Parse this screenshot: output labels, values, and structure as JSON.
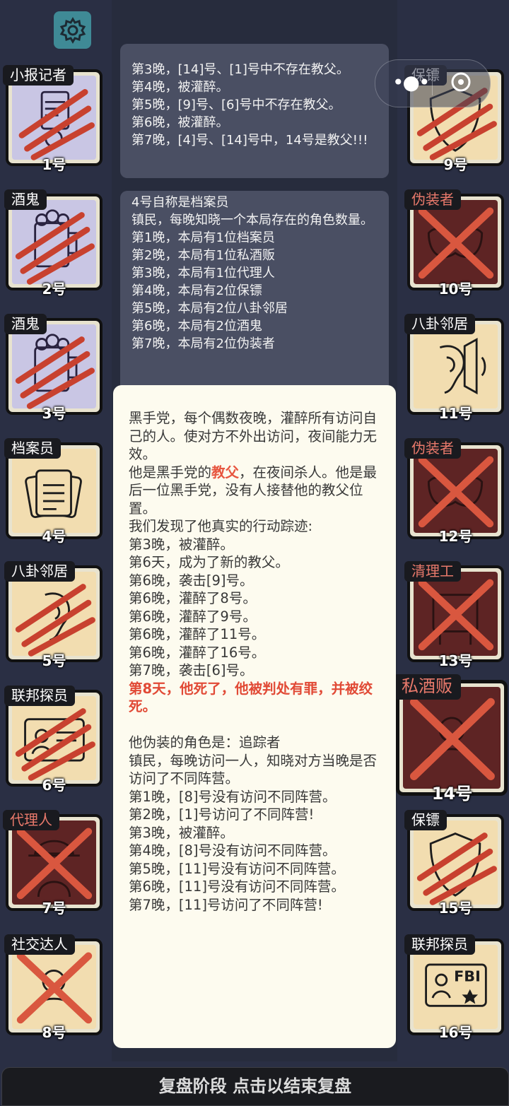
{
  "app": {
    "footer_text": "复盘阶段 点击以结束复盘"
  },
  "players": [
    {
      "num": "1号",
      "role": "小报记者",
      "scratched": true
    },
    {
      "num": "2号",
      "role": "酒鬼",
      "scratched": true
    },
    {
      "num": "3号",
      "role": "酒鬼",
      "scratched": true
    },
    {
      "num": "4号",
      "role": "档案员",
      "scratched": false
    },
    {
      "num": "5号",
      "role": "八卦邻居",
      "scratched": true
    },
    {
      "num": "6号",
      "role": "联邦探员",
      "scratched": true
    },
    {
      "num": "7号",
      "role": "代理人",
      "crossed": true
    },
    {
      "num": "8号",
      "role": "社交达人",
      "crossed": true
    },
    {
      "num": "9号",
      "role": "保镖",
      "scratched": true
    },
    {
      "num": "10号",
      "role": "伪装者",
      "crossed": true
    },
    {
      "num": "11号",
      "role": "八卦邻居",
      "scratched": false
    },
    {
      "num": "12号",
      "role": "伪装者",
      "crossed": true
    },
    {
      "num": "13号",
      "role": "清理工",
      "crossed": true
    },
    {
      "num": "14号",
      "role": "私酒贩",
      "crossed": true
    },
    {
      "num": "15号",
      "role": "保镖",
      "scratched": true
    },
    {
      "num": "16号",
      "role": "联邦探员",
      "scratched": false
    }
  ],
  "log": {
    "bubble1": "第3晚，[14]号、[1]号中不存在教父。\n第4晚，被灌醉。\n第5晚，[9]号、[6]号中不存在教父。\n第6晚，被灌醉。\n第7晚，[4]号、[14]号中，14号是教父!!!",
    "bubble2": "4号自称是档案员\n镇民，每晚知晓一个本局存在的角色数量。\n第1晚，本局有1位档案员\n第2晚，本局有1位私酒贩\n第3晚，本局有1位代理人\n第4晚，本局有2位保镖\n第5晚，本局有2位八卦邻居\n第6晚，本局有2位酒鬼\n第7晚，本局有2位伪装者"
  },
  "popup": {
    "p1": "黑手党，每个偶数夜晚，灌醉所有访问自己的人。使对方不外出访问，夜间能力无效。\n他是黑手党的",
    "highlight": "教父",
    "p2": "，在夜间杀人。他是最后一位黑手党，没有人接替他的教父位置。\n我们发现了他真实的行动踪迹:\n第3晚，被灌醉。\n第6天，成为了新的教父。\n第6晚，袭击[9]号。\n第6晚，灌醉了8号。\n第6晚，灌醉了9号。\n第6晚，灌醉了11号。\n第6晚，灌醉了16号。\n第7晚，袭击[6]号。",
    "death": "第8天，他死了，他被判处有罪，并被绞死。",
    "p3": "\n他伪装的角色是：追踪者\n镇民，每晚访问一人，知晓对方当晚是否访问了不同阵营。\n第1晚，[8]号没有访问不同阵营。\n第2晚，[1]号访问了不同阵营!\n第3晚，被灌醉。\n第4晚，[8]号没有访问不同阵营。\n第5晚，[11]号没有访问不同阵营。\n第6晚，[11]号没有访问不同阵营。\n第7晚，[11]号访问了不同阵营!"
  },
  "colors": {
    "background": "#2a2f44",
    "accent_red": "#e14a36",
    "popup_bg": "#fdfbef"
  }
}
